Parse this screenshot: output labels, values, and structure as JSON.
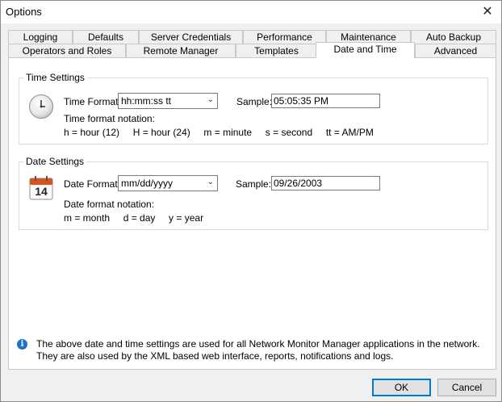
{
  "window": {
    "title": "Options",
    "close_glyph": "✕"
  },
  "tabs_row1": [
    "Logging",
    "Defaults",
    "Server Credentials",
    "Performance",
    "Maintenance",
    "Auto Backup"
  ],
  "tabs_row2": [
    "Operators and Roles",
    "Remote Manager",
    "Templates",
    "Date and Time",
    "Advanced"
  ],
  "active_tab": "Date and Time",
  "time_settings": {
    "group_label": "Time Settings",
    "format_label": "Time Format:",
    "format_value": "hh:mm:ss tt",
    "sample_label": "Sample:",
    "sample_value": "05:05:35 PM",
    "notation_title": "Time format notation:",
    "notation": "h = hour (12)     H = hour (24)     m = minute     s = second     tt = AM/PM"
  },
  "date_settings": {
    "group_label": "Date Settings",
    "format_label": "Date Format:",
    "format_value": "mm/dd/yyyy",
    "sample_label": "Sample:",
    "sample_value": "09/26/2003",
    "notation_title": "Date format notation:",
    "notation": "m = month     d = day     y = year",
    "calendar_day": "14"
  },
  "info": {
    "icon": "i",
    "text": "The above date and time settings are used for all Network Monitor Manager applications in the network. They are also used by the XML based web interface, reports, notifications and logs."
  },
  "buttons": {
    "ok": "OK",
    "cancel": "Cancel"
  },
  "colors": {
    "info_icon": "#1e73c8",
    "calendar_header": "#d9531e",
    "default_button_border": "#0078d7"
  }
}
